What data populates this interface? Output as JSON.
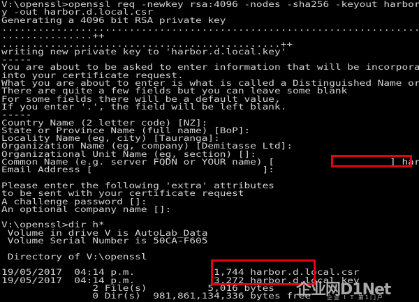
{
  "console": {
    "lines": [
      "V:\\openssl>openssl req -newkey rsa:4096 -nodes -sha256 -keyout harbor.d.local.key",
      "y -out harbor.d.local.csr",
      "Generating a 4096 bit RSA private key",
      "...............................................................................",
      "...............++",
      "..............................................++",
      "writing new private key to 'harbor.d.local.key'",
      "-----",
      "You are about to be asked to enter information that will be incorporated",
      "into your certificate request.",
      "What you are about to enter is what is called a Distinguished Name or a DN.",
      "There are quite a few fields but you can leave some blank",
      "For some fields there will be a default value,",
      "If you enter '.', the field will be left blank.",
      "-----",
      "Country Name (2 letter code) [NZ]:",
      "State or Province Name (full name) [BoP]:",
      "Locality Name (eg, city) [Tauranga]:",
      "Organization Name (eg, company) [Demitasse Ltd]:",
      "Organizational Unit Name (eg, section) []:",
      "Common Name (e.g. server FQDN or YOUR name) [                   ] harbor.d.local",
      "Email Address [                            ]:",
      "",
      "Please enter the following 'extra' attributes",
      "to be sent with your certificate request",
      "A challenge password []:",
      "An optional company name []:",
      "",
      "V:\\openssl>dir h*",
      " Volume in drive V is AutoLab_Data",
      " Volume Serial Number is 50CA-F605",
      "",
      " Directory of V:\\openssl",
      "",
      "19/05/2017  04:14 p.m.             1,744 harbor.d.local.csr",
      "19/05/2017  04:14 p.m.             3,272 harbor.d.local.key",
      "               2 File(s)          5,016 bytes",
      "               0 Dir(s)  981,861,134,336 bytes free"
    ]
  },
  "watermark": {
    "logo": "企业网D1Net",
    "sub": "企业 I T 第1门户"
  },
  "colors": {
    "background": "#000000",
    "text": "#d4d4d4",
    "highlight": "#e60012"
  }
}
